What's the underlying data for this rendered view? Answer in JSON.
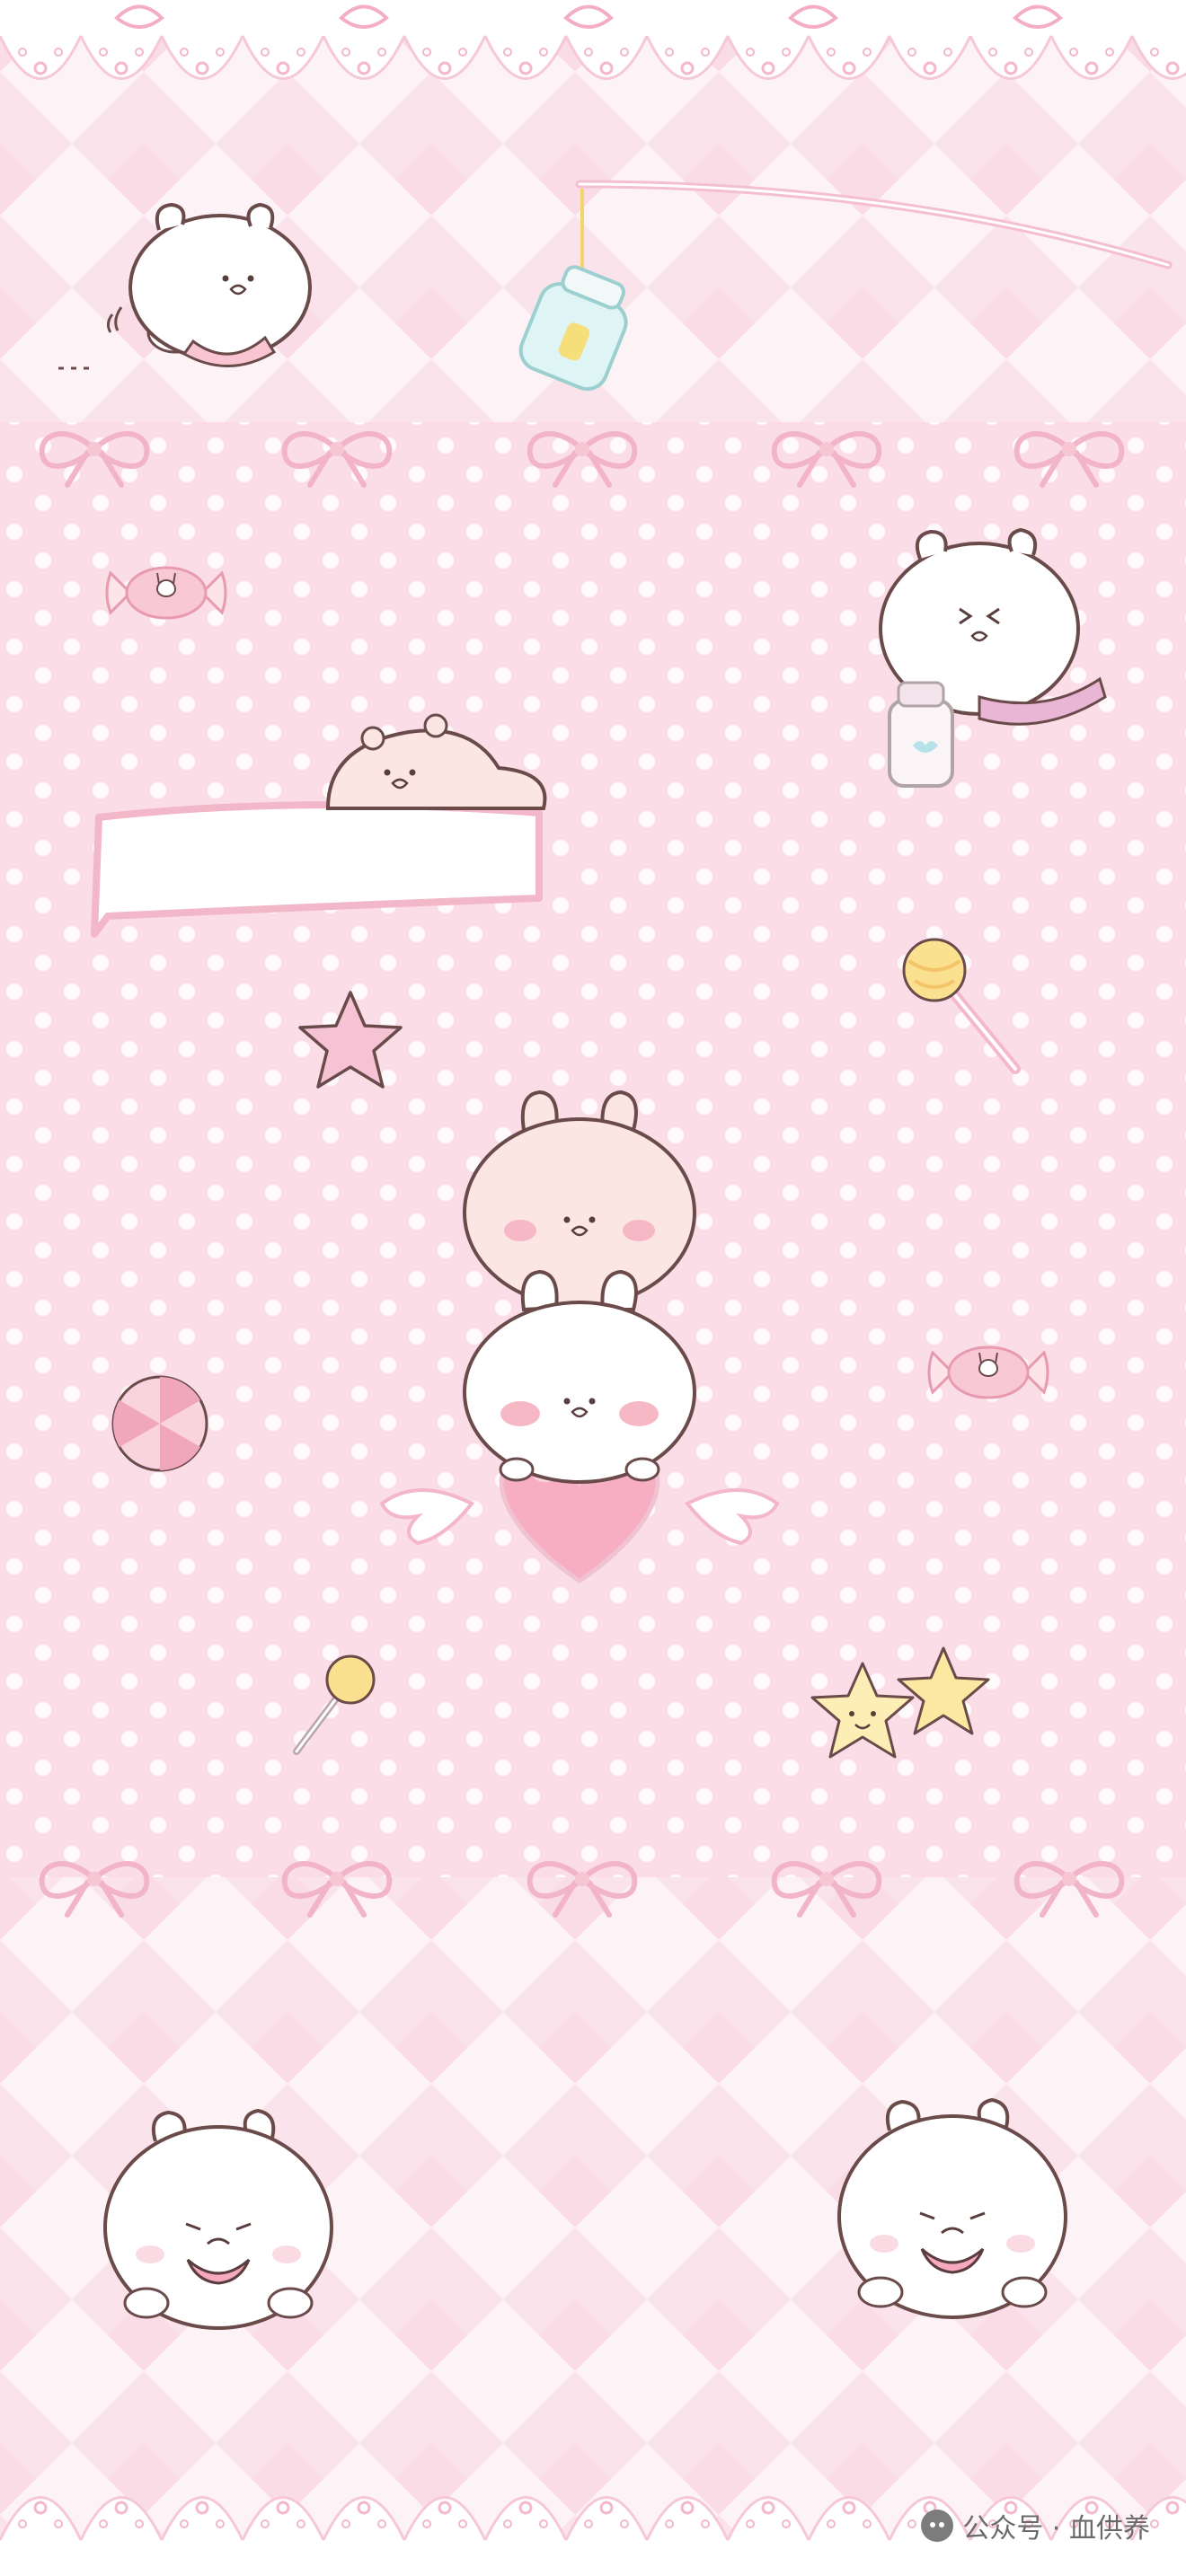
{
  "wallpaper": {
    "palette": {
      "base_pink": "#fbe3ec",
      "lattice_pink": "#f7d3e0",
      "light_pink": "#fdf1f5",
      "polka_dot": "#ffffff",
      "ribbon_pink": "#f2b5c8",
      "outline_brown": "#6b4a4a",
      "blush": "#f7b8c6",
      "heart_pink": "#f6a9bf",
      "candy_yellow": "#fbeca0",
      "bottle_blue": "#d9f3f3"
    },
    "motifs": [
      "lace-border",
      "bow-ribbon",
      "bunny",
      "sleeping-bear",
      "name-tag",
      "candy",
      "lollipop",
      "star",
      "heart",
      "wing",
      "milk-bottle",
      "peppermint",
      "fishing-rod"
    ]
  },
  "watermark": {
    "icon": "wechat-icon",
    "text": "公众号 · 血供养"
  }
}
